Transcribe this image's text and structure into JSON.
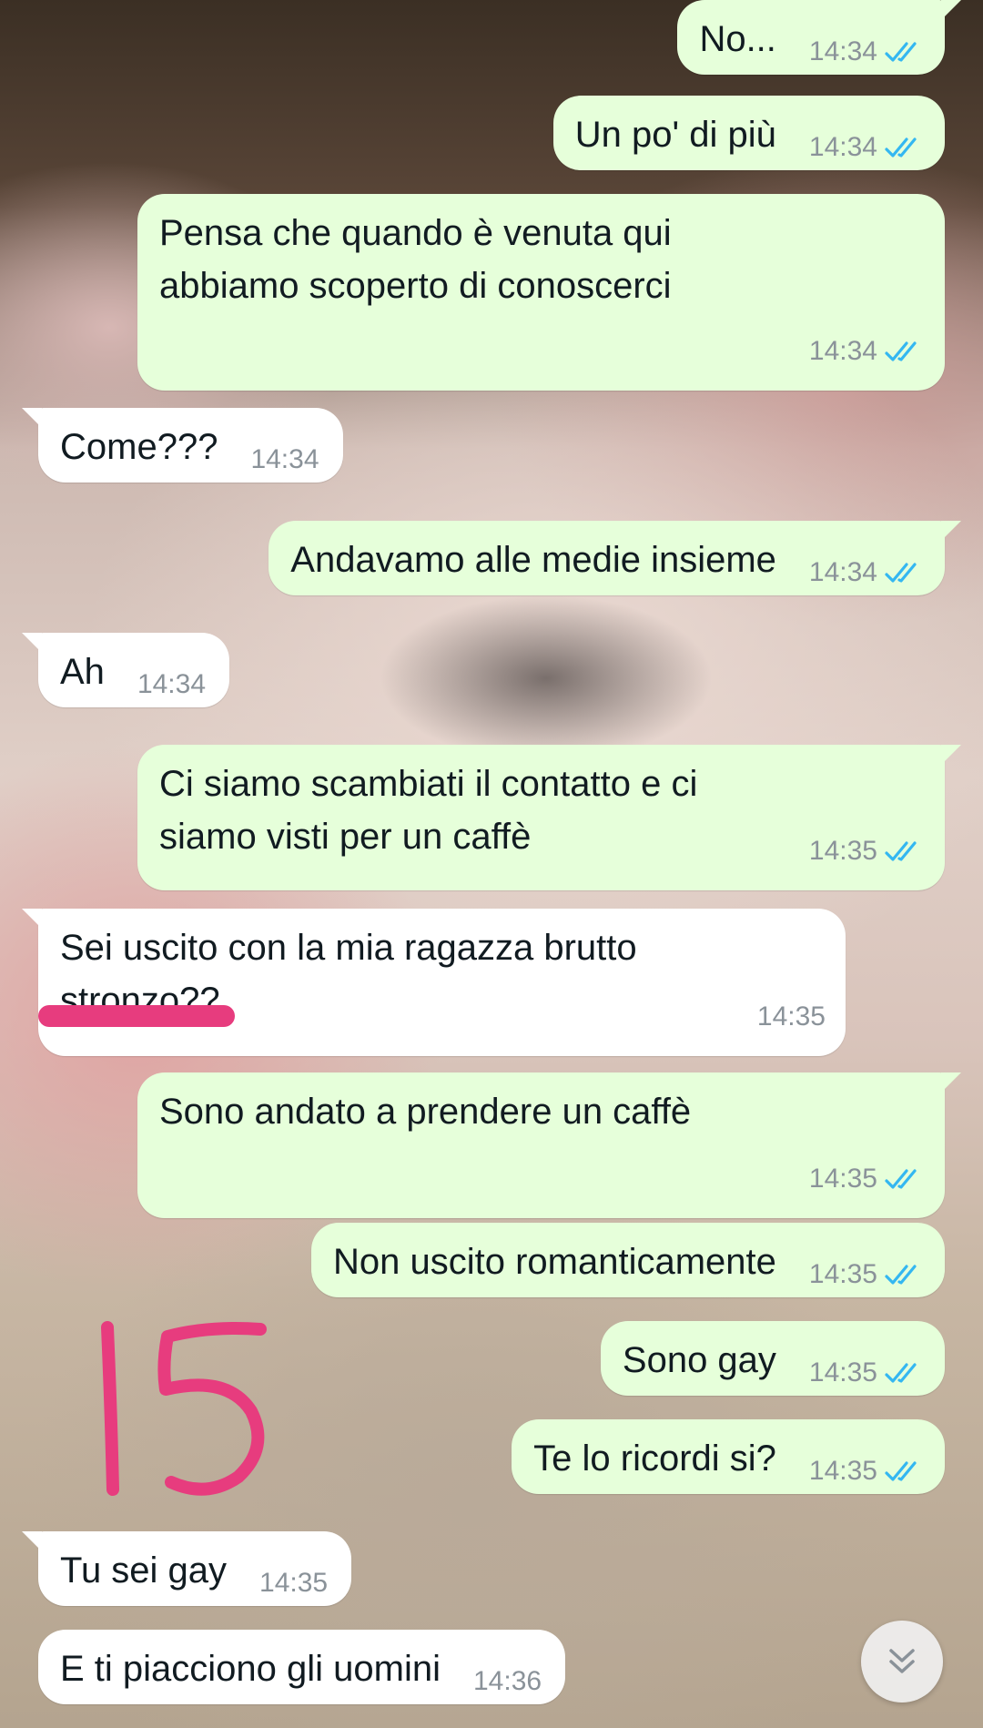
{
  "colors": {
    "outgoing_bubble": "#e6ffda",
    "incoming_bubble": "#ffffff",
    "timestamp": "#8a9299",
    "read_ticks": "#34b7f1",
    "annotation": "#e73c7e"
  },
  "messages": [
    {
      "direction": "outgoing",
      "text": "No...",
      "time": "14:34",
      "status": "read"
    },
    {
      "direction": "outgoing",
      "text": "Un po' di più",
      "time": "14:34",
      "status": "read"
    },
    {
      "direction": "outgoing",
      "text": "Pensa che quando è venuta qui\nabbiamo scoperto di conoscerci",
      "time": "14:34",
      "status": "read"
    },
    {
      "direction": "incoming",
      "text": "Come???",
      "time": "14:34"
    },
    {
      "direction": "outgoing",
      "text": "Andavamo alle medie insieme",
      "time": "14:34",
      "status": "read"
    },
    {
      "direction": "incoming",
      "text": "Ah",
      "time": "14:34"
    },
    {
      "direction": "outgoing",
      "text": "Ci siamo scambiati il contatto e ci\nsiamo visti per un caffè",
      "time": "14:35",
      "status": "read"
    },
    {
      "direction": "incoming",
      "text": "Sei uscito con la mia ragazza brutto\nstronzo??",
      "time": "14:35"
    },
    {
      "direction": "outgoing",
      "text": "Sono andato a prendere un caffè",
      "time": "14:35",
      "status": "read"
    },
    {
      "direction": "outgoing",
      "text": "Non uscito romanticamente",
      "time": "14:35",
      "status": "read"
    },
    {
      "direction": "outgoing",
      "text": "Sono gay",
      "time": "14:35",
      "status": "read"
    },
    {
      "direction": "outgoing",
      "text": "Te lo ricordi si?",
      "time": "14:35",
      "status": "read"
    },
    {
      "direction": "incoming",
      "text": "Tu sei gay",
      "time": "14:35"
    },
    {
      "direction": "incoming",
      "text": "E ti piacciono gli uomini",
      "time": "14:36"
    }
  ],
  "annotation": {
    "handwritten_number": "15"
  },
  "scroll_button": {
    "icon": "double-chevron-down-icon"
  }
}
